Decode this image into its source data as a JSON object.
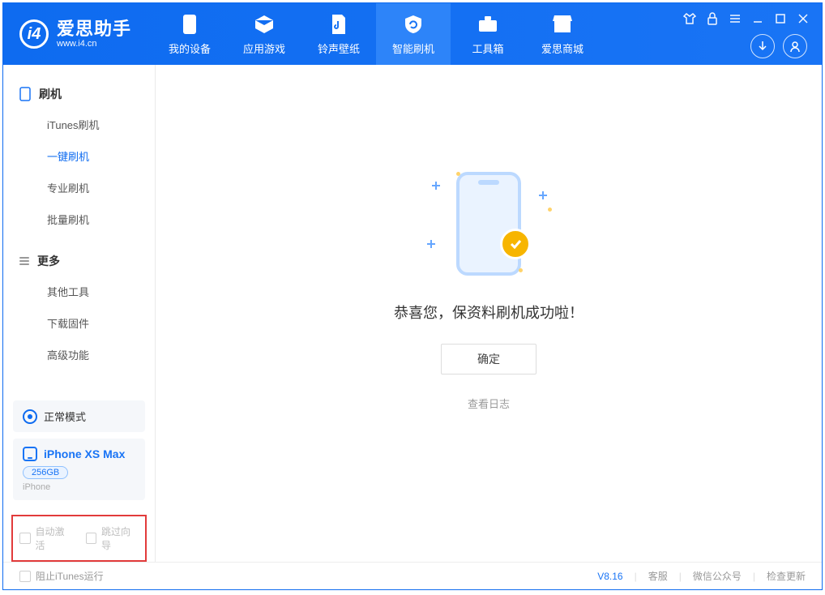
{
  "app": {
    "title": "爱思助手",
    "subtitle": "www.i4.cn"
  },
  "tabs": {
    "device": "我的设备",
    "apps": "应用游戏",
    "ringtones": "铃声壁纸",
    "flash": "智能刷机",
    "toolbox": "工具箱",
    "store": "爱思商城"
  },
  "sidebar": {
    "flash_group": "刷机",
    "items": {
      "itunes": "iTunes刷机",
      "onekey": "一键刷机",
      "pro": "专业刷机",
      "batch": "批量刷机"
    },
    "more_group": "更多",
    "more": {
      "other_tools": "其他工具",
      "download_fw": "下载固件",
      "advanced": "高级功能"
    },
    "mode_label": "正常模式",
    "device": {
      "name": "iPhone XS Max",
      "storage": "256GB",
      "type": "iPhone"
    },
    "auto_activate": "自动激活",
    "skip_guide": "跳过向导"
  },
  "main": {
    "success": "恭喜您，保资料刷机成功啦！",
    "ok": "确定",
    "view_log": "查看日志"
  },
  "footer": {
    "block_itunes": "阻止iTunes运行",
    "version": "V8.16",
    "support": "客服",
    "wechat": "微信公众号",
    "check_update": "检查更新"
  }
}
